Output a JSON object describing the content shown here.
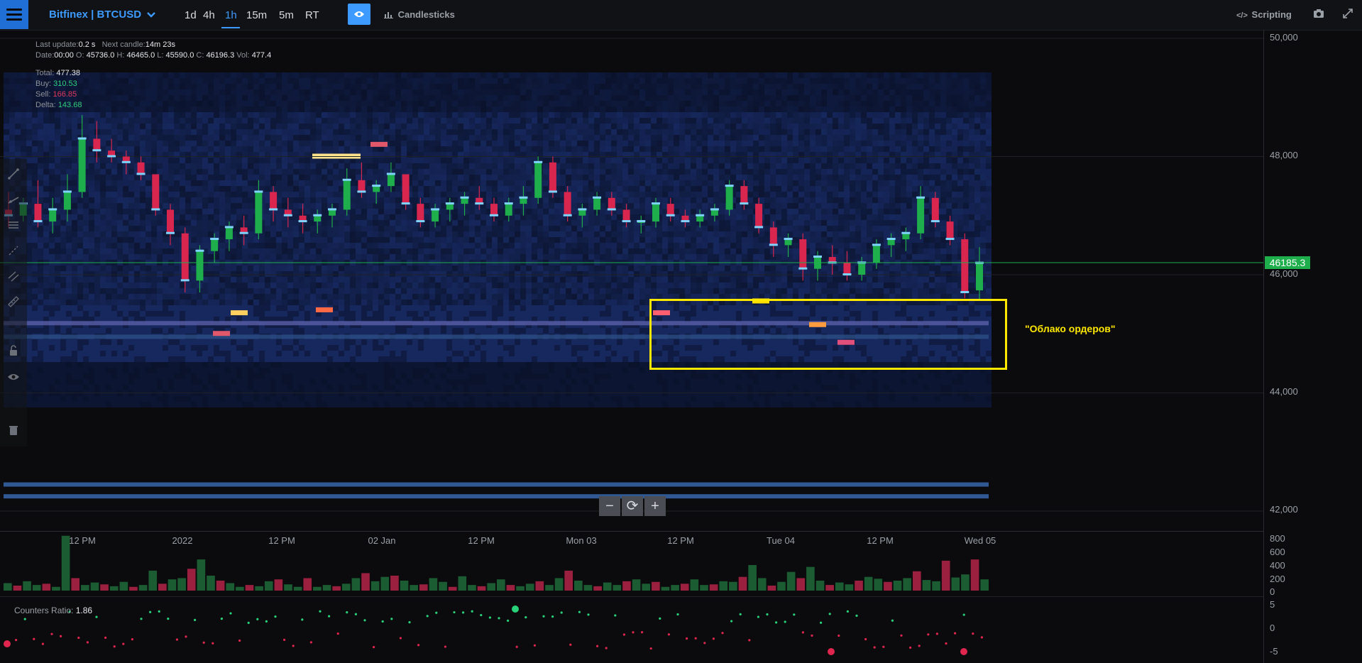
{
  "toolbar": {
    "symbol": "Bitfinex | BTCUSD",
    "timeframes": [
      "1d",
      "4h",
      "1h",
      "15m",
      "5m",
      "RT"
    ],
    "active_timeframe": "1h",
    "chart_type": "Candlesticks",
    "scripting": "Scripting"
  },
  "info": {
    "last_update_label": "Last update:",
    "last_update": "0.2 s",
    "next_candle_label": "Next candle:",
    "next_candle": "14m 23s",
    "date_label": "Date:",
    "date": "00:00",
    "o_label": "O:",
    "o": "45736.0",
    "h_label": "H:",
    "h": "46465.0",
    "l_label": "L:",
    "l": "45590.0",
    "c_label": "C:",
    "c": "46196.3",
    "vol_label": "Vol:",
    "vol": "477.4",
    "total_label": "Total:",
    "total": "477.38",
    "buy_label": "Buy:",
    "buy": "310.53",
    "sell_label": "Sell:",
    "sell": "166.85",
    "delta_label": "Delta:",
    "delta": "143.68"
  },
  "price_axis": [
    "50,000",
    "48,000",
    "46,000",
    "44,000",
    "42,000"
  ],
  "current_price": "46185.3",
  "time_axis": [
    "12 PM",
    "2022",
    "12 PM",
    "02 Jan",
    "12 PM",
    "Mon 03",
    "12 PM",
    "Tue 04",
    "12 PM",
    "Wed 05"
  ],
  "volume_axis": [
    "800",
    "600",
    "400",
    "200",
    "0"
  ],
  "ratio_axis": [
    "5",
    "0",
    "-5"
  ],
  "ratio": {
    "label": "Counters Ratio:",
    "value": "1.86"
  },
  "annotation": "\"Облако ордеров\"",
  "zoom": {
    "minus": "−",
    "reset": "⟳",
    "plus": "+"
  },
  "colors": {
    "accent": "#3d9bff",
    "up": "#1fae4c",
    "down": "#d8264f",
    "highlight": "#ffe800"
  },
  "chart_data": {
    "type": "candlestick",
    "timeframe": "1h",
    "y_range": [
      41800,
      50200
    ],
    "last_candle": {
      "open": 45736.0,
      "high": 46465.0,
      "low": 45590.0,
      "close": 46196.3,
      "volume": 477.4
    },
    "ohlc_approx": [
      [
        47100,
        47400,
        46800,
        47000
      ],
      [
        47000,
        47300,
        46900,
        47200
      ],
      [
        47200,
        47600,
        46800,
        46900
      ],
      [
        46900,
        47300,
        46700,
        47100
      ],
      [
        47100,
        47700,
        46900,
        47400
      ],
      [
        47400,
        48700,
        47300,
        48300
      ],
      [
        48300,
        48600,
        47900,
        48100
      ],
      [
        48100,
        48300,
        47900,
        48000
      ],
      [
        48000,
        48100,
        47700,
        47900
      ],
      [
        47900,
        48000,
        47600,
        47700
      ],
      [
        47700,
        47700,
        47000,
        47100
      ],
      [
        47100,
        47200,
        46500,
        46700
      ],
      [
        46700,
        46800,
        45700,
        45900
      ],
      [
        45900,
        46500,
        45700,
        46400
      ],
      [
        46400,
        46700,
        46200,
        46600
      ],
      [
        46600,
        46900,
        46400,
        46800
      ],
      [
        46800,
        47000,
        46500,
        46700
      ],
      [
        46700,
        47600,
        46600,
        47400
      ],
      [
        47400,
        47500,
        46900,
        47100
      ],
      [
        47100,
        47300,
        46800,
        47000
      ],
      [
        47000,
        47200,
        46700,
        46900
      ],
      [
        46900,
        47100,
        46700,
        47000
      ],
      [
        47000,
        47200,
        46800,
        47100
      ],
      [
        47100,
        47800,
        47000,
        47600
      ],
      [
        47600,
        47900,
        47300,
        47400
      ],
      [
        47400,
        47600,
        47200,
        47500
      ],
      [
        47500,
        47900,
        47400,
        47700
      ],
      [
        47700,
        47700,
        47100,
        47200
      ],
      [
        47200,
        47300,
        46800,
        46900
      ],
      [
        46900,
        47200,
        46800,
        47100
      ],
      [
        47100,
        47300,
        46900,
        47200
      ],
      [
        47200,
        47400,
        47000,
        47300
      ],
      [
        47300,
        47500,
        47100,
        47200
      ],
      [
        47200,
        47300,
        46900,
        47000
      ],
      [
        47000,
        47300,
        46900,
        47200
      ],
      [
        47200,
        47500,
        47000,
        47300
      ],
      [
        47300,
        48000,
        47200,
        47900
      ],
      [
        47900,
        48000,
        47300,
        47400
      ],
      [
        47400,
        47500,
        46900,
        47000
      ],
      [
        47000,
        47200,
        46800,
        47100
      ],
      [
        47100,
        47400,
        47000,
        47300
      ],
      [
        47300,
        47400,
        47000,
        47100
      ],
      [
        47100,
        47200,
        46800,
        46900
      ],
      [
        46900,
        47000,
        46700,
        46900
      ],
      [
        46900,
        47300,
        46800,
        47200
      ],
      [
        47200,
        47300,
        46900,
        47000
      ],
      [
        47000,
        47100,
        46800,
        46900
      ],
      [
        46900,
        47100,
        46800,
        47000
      ],
      [
        47000,
        47200,
        46900,
        47100
      ],
      [
        47100,
        47600,
        47000,
        47500
      ],
      [
        47500,
        47600,
        47100,
        47200
      ],
      [
        47200,
        47300,
        46700,
        46800
      ],
      [
        46800,
        46900,
        46300,
        46500
      ],
      [
        46500,
        46700,
        46300,
        46600
      ],
      [
        46600,
        46700,
        45900,
        46100
      ],
      [
        46100,
        46400,
        45900,
        46300
      ],
      [
        46300,
        46500,
        46000,
        46200
      ],
      [
        46200,
        46400,
        45900,
        46000
      ],
      [
        46000,
        46300,
        45900,
        46200
      ],
      [
        46200,
        46600,
        46100,
        46500
      ],
      [
        46500,
        46700,
        46300,
        46600
      ],
      [
        46600,
        46800,
        46400,
        46700
      ],
      [
        46700,
        47500,
        46600,
        47300
      ],
      [
        47300,
        47400,
        46800,
        46900
      ],
      [
        46900,
        47000,
        46500,
        46600
      ],
      [
        46600,
        46700,
        45600,
        45700
      ],
      [
        45736,
        46465,
        45590,
        46196.3
      ]
    ],
    "order_cloud": {
      "label": "\"Облако ордеров\"",
      "price_band": [
        44600,
        45500
      ]
    },
    "volume": [
      120,
      80,
      150,
      90,
      110,
      60,
      880,
      200,
      90,
      130,
      100,
      70,
      140,
      60,
      90,
      320,
      110,
      180,
      200,
      350,
      500,
      240,
      160,
      120,
      60,
      90,
      70,
      150,
      180,
      100,
      60,
      200,
      60,
      90,
      70,
      110,
      200,
      280,
      150,
      220,
      240,
      160,
      90,
      100,
      200,
      140,
      60,
      230,
      90,
      70,
      120,
      180,
      90,
      70,
      110,
      150,
      90,
      200,
      320,
      160,
      90,
      70,
      130,
      90,
      150,
      180,
      110,
      140,
      60,
      90,
      110,
      180,
      90,
      100,
      150,
      140,
      220,
      410,
      200,
      80,
      140,
      300,
      200,
      380,
      160,
      90,
      130,
      100,
      160,
      220,
      190,
      140,
      160,
      200,
      310,
      170,
      150,
      480,
      210,
      260,
      500,
      180
    ],
    "counters_ratio": 1.86
  }
}
